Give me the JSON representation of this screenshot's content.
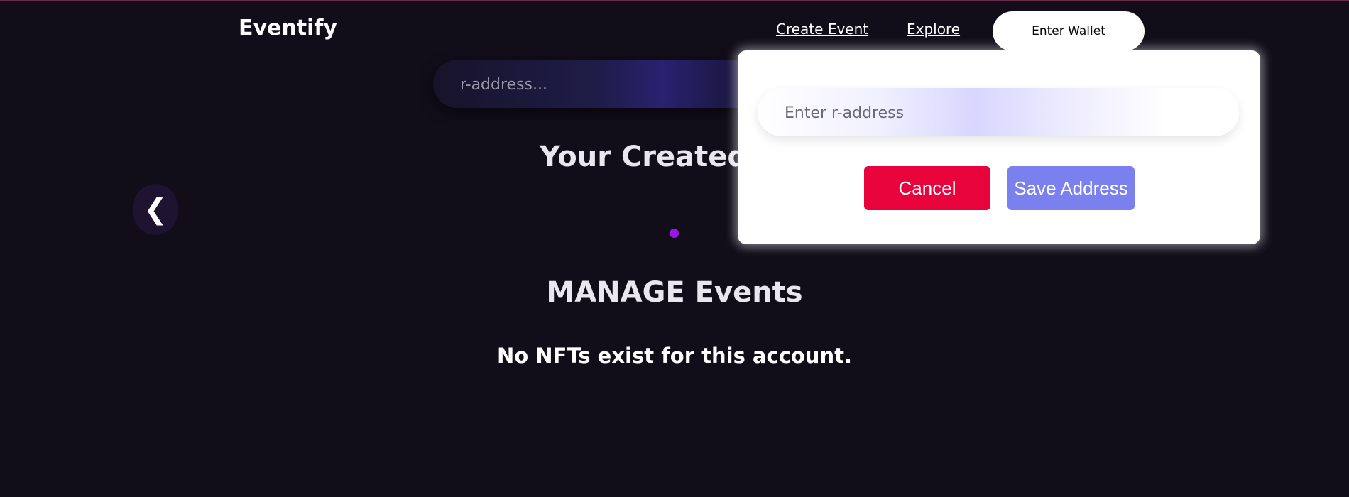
{
  "header": {
    "brand": "Eventify",
    "nav": {
      "create_event": "Create Event",
      "explore": "Explore"
    },
    "wallet_button": "Enter Wallet"
  },
  "search": {
    "placeholder": "r-address..."
  },
  "main": {
    "created_title": "Your Created Events",
    "prev_arrow": "❮",
    "manage_title": "MANAGE Events",
    "empty_message": "No NFTs exist for this account."
  },
  "modal": {
    "input_placeholder": "Enter r-address",
    "cancel_label": "Cancel",
    "save_label": "Save Address"
  },
  "colors": {
    "background": "#110d19",
    "accent_dot": "#9b16e6",
    "cancel": "#e8033c",
    "save": "#7b80ef"
  }
}
